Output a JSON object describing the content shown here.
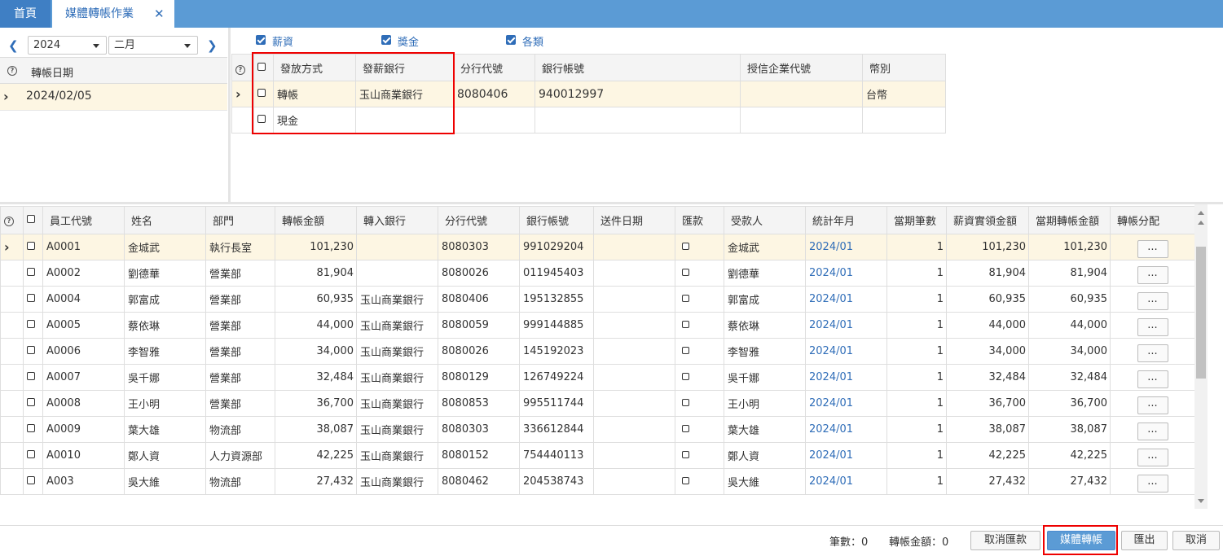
{
  "tabs": {
    "home": "首頁",
    "active": "媒體轉帳作業"
  },
  "left": {
    "year": "2024",
    "month": "二月",
    "column_header": "轉帳日期",
    "rows": [
      "2024/02/05"
    ]
  },
  "filters": {
    "salary": "薪資",
    "bonus": "獎金",
    "misc": "各類"
  },
  "pay_table": {
    "headers": [
      "發放方式",
      "發薪銀行",
      "分行代號",
      "銀行帳號",
      "授信企業代號",
      "幣別"
    ],
    "rows": [
      [
        "轉帳",
        "玉山商業銀行",
        "8080406",
        "940012997",
        "",
        "台幣"
      ],
      [
        "現金",
        "",
        "",
        "",
        "",
        ""
      ]
    ]
  },
  "emp_table": {
    "headers": [
      "員工代號",
      "姓名",
      "部門",
      "轉帳金額",
      "轉入銀行",
      "分行代號",
      "銀行帳號",
      "送件日期",
      "匯款",
      "受款人",
      "統計年月",
      "當期筆數",
      "薪資實領金額",
      "當期轉帳金額",
      "轉帳分配"
    ],
    "button_label": "...",
    "rows": [
      [
        "A0001",
        "金城武",
        "執行長室",
        "101,230",
        "",
        "8080303",
        "991029204",
        "",
        "",
        "金城武",
        "2024/01",
        "1",
        "101,230",
        "101,230"
      ],
      [
        "A0002",
        "劉德華",
        "營業部",
        "81,904",
        "",
        "8080026",
        "011945403",
        "",
        "",
        "劉德華",
        "2024/01",
        "1",
        "81,904",
        "81,904"
      ],
      [
        "A0004",
        "郭富成",
        "營業部",
        "60,935",
        "玉山商業銀行",
        "8080406",
        "195132855",
        "",
        "",
        "郭富成",
        "2024/01",
        "1",
        "60,935",
        "60,935"
      ],
      [
        "A0005",
        "蔡依琳",
        "營業部",
        "44,000",
        "玉山商業銀行",
        "8080059",
        "999144885",
        "",
        "",
        "蔡依琳",
        "2024/01",
        "1",
        "44,000",
        "44,000"
      ],
      [
        "A0006",
        "李智雅",
        "營業部",
        "34,000",
        "玉山商業銀行",
        "8080026",
        "145192023",
        "",
        "",
        "李智雅",
        "2024/01",
        "1",
        "34,000",
        "34,000"
      ],
      [
        "A0007",
        "吳千娜",
        "營業部",
        "32,484",
        "玉山商業銀行",
        "8080129",
        "126749224",
        "",
        "",
        "吳千娜",
        "2024/01",
        "1",
        "32,484",
        "32,484"
      ],
      [
        "A0008",
        "王小明",
        "營業部",
        "36,700",
        "玉山商業銀行",
        "8080853",
        "995511744",
        "",
        "",
        "王小明",
        "2024/01",
        "1",
        "36,700",
        "36,700"
      ],
      [
        "A0009",
        "葉大雄",
        "物流部",
        "38,087",
        "玉山商業銀行",
        "8080303",
        "336612844",
        "",
        "",
        "葉大雄",
        "2024/01",
        "1",
        "38,087",
        "38,087"
      ],
      [
        "A0010",
        "鄭人資",
        "人力資源部",
        "42,225",
        "玉山商業銀行",
        "8080152",
        "754440113",
        "",
        "",
        "鄭人資",
        "2024/01",
        "1",
        "42,225",
        "42,225"
      ],
      [
        "A003",
        "吳大維",
        "物流部",
        "27,432",
        "玉山商業銀行",
        "8080462",
        "204538743",
        "",
        "",
        "吳大維",
        "2024/01",
        "1",
        "27,432",
        "27,432"
      ]
    ]
  },
  "footer": {
    "count_label": "筆數：0",
    "amount_label": "轉帳金額：0",
    "cancel_remit": "取消匯款",
    "media_transfer": "媒體轉帳",
    "export": "匯出",
    "cancel": "取消"
  },
  "colors": {
    "tab_bar": "#5b9bd5",
    "accent": "#2f6db8",
    "selected_row": "#fdf6e3",
    "highlight_box": "#e00000"
  }
}
